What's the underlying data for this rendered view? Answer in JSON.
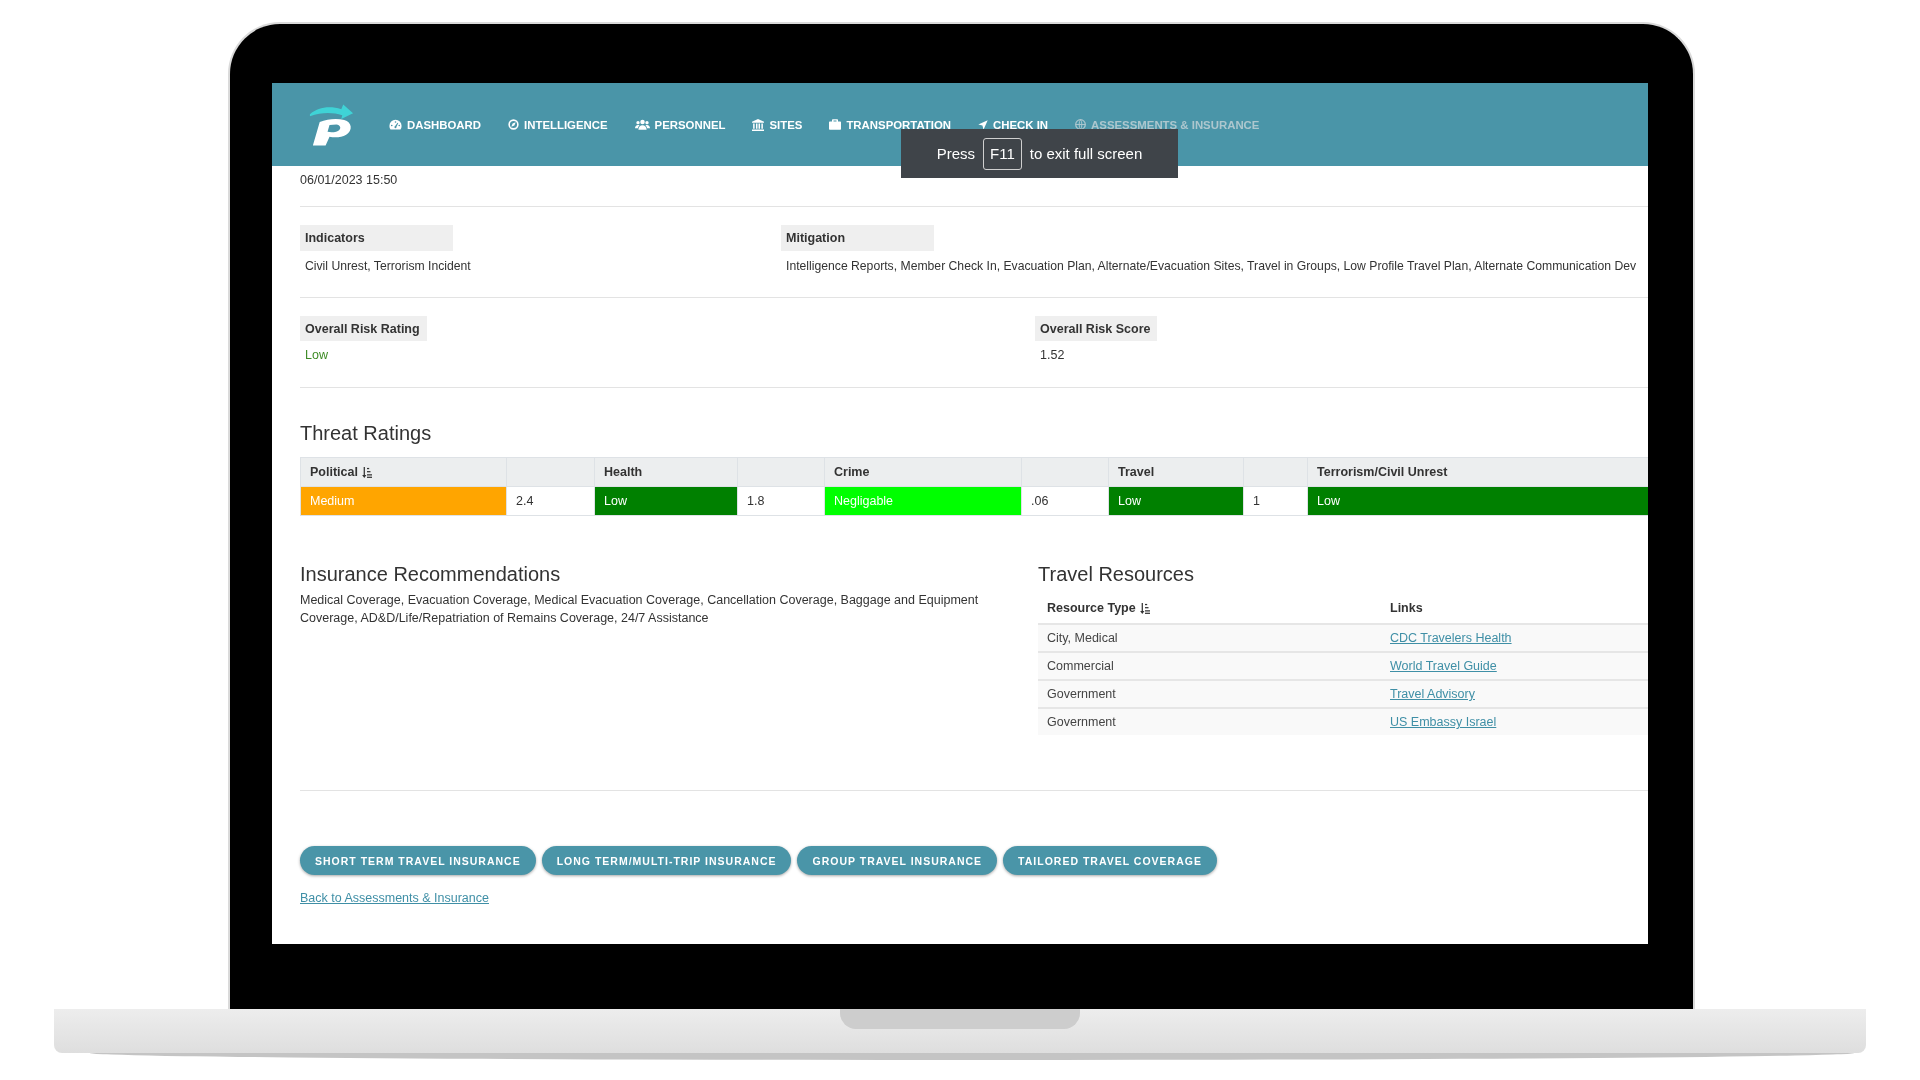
{
  "navbar": {
    "items": [
      {
        "label": "DASHBOARD",
        "selected": false
      },
      {
        "label": "INTELLIGENCE",
        "selected": false
      },
      {
        "label": "PERSONNEL",
        "selected": false
      },
      {
        "label": "SITES",
        "selected": false
      },
      {
        "label": "TRANSPORTATION",
        "selected": false
      },
      {
        "label": "CHECK IN",
        "selected": false
      },
      {
        "label": "ASSESSMENTS & INSURANCE",
        "selected": true
      }
    ]
  },
  "fullscreen_notice": {
    "before": "Press",
    "key": "F11",
    "after": "to exit full screen"
  },
  "timestamp": "06/01/2023 15:50",
  "indicators": {
    "label": "Indicators",
    "value": "Civil Unrest, Terrorism Incident"
  },
  "mitigation": {
    "label": "Mitigation",
    "value": "Intelligence Reports, Member Check In, Evacuation Plan, Alternate/Evacuation Sites, Travel in Groups, Low Profile Travel Plan, Alternate Communication Dev"
  },
  "overall_risk_rating": {
    "label": "Overall Risk Rating",
    "value": "Low"
  },
  "overall_risk_score": {
    "label": "Overall Risk Score",
    "value": "1.52"
  },
  "threat_ratings": {
    "title": "Threat Ratings",
    "categories": [
      {
        "name": "Political",
        "sorted": true,
        "rating": "Medium",
        "color": "#ffa500",
        "score": "2.4"
      },
      {
        "name": "Health",
        "sorted": false,
        "rating": "Low",
        "color": "#008000",
        "score": "1.8"
      },
      {
        "name": "Crime",
        "sorted": false,
        "rating": "Negligable",
        "color": "#00ff00",
        "score": ".06"
      },
      {
        "name": "Travel",
        "sorted": false,
        "rating": "Low",
        "color": "#008000",
        "score": "1"
      },
      {
        "name": "Terrorism/Civil Unrest",
        "sorted": false,
        "rating": "Low",
        "color": "#008000"
      }
    ]
  },
  "insurance_recommendations": {
    "title": "Insurance Recommendations",
    "text": "Medical Coverage, Evacuation Coverage, Medical Evacuation Coverage, Cancellation Coverage, Baggage and Equipment Coverage, AD&D/Life/Repatriation of Remains Coverage, 24/7 Assistance"
  },
  "travel_resources": {
    "title": "Travel Resources",
    "columns": [
      {
        "label": "Resource Type",
        "sorted": true
      },
      {
        "label": "Links",
        "sorted": false
      }
    ],
    "rows": [
      {
        "resource_type": "City, Medical",
        "link": "CDC Travelers Health"
      },
      {
        "resource_type": "Commercial",
        "link": "World Travel Guide"
      },
      {
        "resource_type": "Government",
        "link": "Travel Advisory"
      },
      {
        "resource_type": "Government",
        "link": "US Embassy Israel"
      }
    ]
  },
  "buttons": [
    "SHORT TERM TRAVEL INSURANCE",
    "LONG TERM/MULTI-TRIP INSURANCE",
    "GROUP TRAVEL INSURANCE",
    "TAILORED TRAVEL COVERAGE"
  ],
  "back_link": "Back to Assessments & Insurance"
}
